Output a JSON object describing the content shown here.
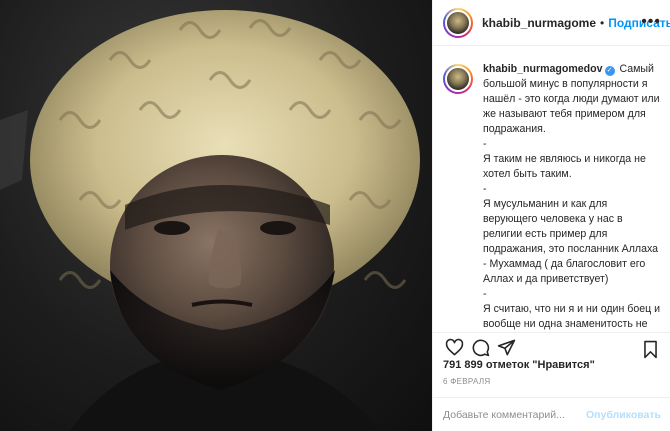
{
  "post": {
    "username": "khabib_nurmagomedov",
    "header_username": "khabib_nurmagome",
    "follow_label": "Подписаться",
    "separator": "•",
    "more_label": "•••",
    "caption": "Самый большой минус в популярности я нашёл - это когда люди думают или же называют тебя примером для подражания.\n-\nЯ таким не являюсь и никогда не хотел быть таким.\n-\nЯ мусульманин и как для верующего человека у нас в религии есть пример для подражания, это посланник Аллаха - Мухаммад ( да благословит его Аллах и да приветствует)\n-\nЯ считаю, что ни я и ни один боец и вообще ни одна знаменитость не заслуживают этого права - быть",
    "likes": "791 899 отметок \"Нравится\"",
    "date": "6 ФЕВРАЛЯ",
    "comment_placeholder": "Добавьте комментарий...",
    "publish_label": "Опубликовать"
  },
  "icons": [
    "heart-icon",
    "comment-icon",
    "share-icon",
    "bookmark-icon",
    "verified-badge-icon",
    "more-icon"
  ],
  "colors": {
    "link": "#0095f6",
    "publish_disabled": "#b2dffc",
    "verified": "#3897f0",
    "muted": "#8e8e8e"
  }
}
